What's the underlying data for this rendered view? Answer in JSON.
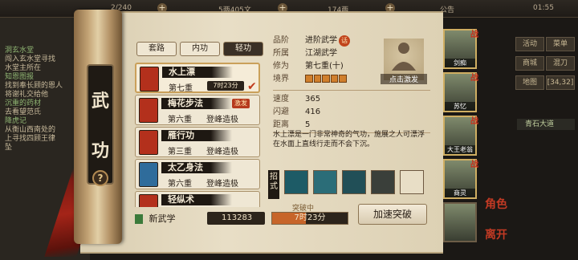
{
  "topbar": {
    "stamina": "2/240",
    "copper": "5两405文",
    "silver": "174两",
    "announcement": "公告",
    "clock": "01:55"
  },
  "quests": [
    {
      "title": "洞玄水堂",
      "lines": [
        "闯入玄水堂寻找",
        "水堂主所在"
      ]
    },
    {
      "title": "知恩图报",
      "lines": [
        "找到奉长顾的恩人",
        "将谢礼交给他"
      ]
    },
    {
      "title": "沉重的药材",
      "lines": [
        "去看望范氏"
      ]
    },
    {
      "title": "降虎记",
      "lines": [
        "从衡山西南处的",
        "上寻找四顾王律",
        "坠"
      ]
    }
  ],
  "panel": {
    "title_chars": [
      "武",
      "功"
    ],
    "help": "?",
    "tabs": [
      "套路",
      "内功",
      "轻功"
    ],
    "active_tab": 2,
    "skills": [
      {
        "name": "水上漂",
        "level": "第七重",
        "timer": "7时23分",
        "book_color": "#b3301c",
        "selected": true
      },
      {
        "name": "梅花步法",
        "level": "第六重",
        "status": "登峰造极",
        "tag": "激发",
        "book_color": "#b3301c"
      },
      {
        "name": "雁行功",
        "level": "第三重",
        "status": "登峰造极",
        "book_color": "#b3301c"
      },
      {
        "name": "太乙身法",
        "level": "第六重",
        "status": "登峰造极",
        "book_color": "#2f6c9b"
      },
      {
        "name": "轻纵术",
        "level": "",
        "status": "",
        "book_color": "#b3301c"
      }
    ],
    "new_skill_label": "新武学",
    "skill_points": "113283"
  },
  "detail": {
    "rows": [
      {
        "k": "品阶",
        "v": "进阶武学",
        "badge": "话"
      },
      {
        "k": "所属",
        "v": "江湖武学"
      },
      {
        "k": "修为",
        "v": "第七重(十)"
      },
      {
        "k": "境界",
        "v": ""
      }
    ],
    "realm_fill": 5,
    "stats": [
      {
        "k": "速度",
        "v": "365"
      },
      {
        "k": "闪避",
        "v": "416"
      },
      {
        "k": "距离",
        "v": "5"
      }
    ],
    "description": "水上漂是一门非常神奇的气功，施展之人可漂浮在水面上直线行走而不会下沉。",
    "portrait_label": "点击激发",
    "moves_label": "招式",
    "breakthrough_label": "突破中",
    "progress_text": "7时23分",
    "progress_fraction": 0.45,
    "speed_button": "加速突破"
  },
  "roster": [
    {
      "name": "剑痴",
      "active": true
    },
    {
      "name": "苏忆",
      "active": true
    },
    {
      "name": "大王老翁",
      "active": true
    },
    {
      "name": "商灵",
      "active": true
    },
    {
      "name": "",
      "active": false
    }
  ],
  "right_menu": [
    "活动",
    "菜单",
    "商城",
    "混刀",
    "地图",
    "[34,32]"
  ],
  "nearby": "青石大道",
  "corner_text": [
    "角色",
    "离开"
  ]
}
